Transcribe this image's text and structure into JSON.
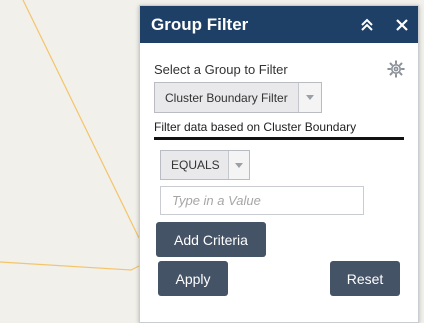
{
  "map": {
    "line_color": "#f4c46a",
    "background": "#f1f0ea"
  },
  "panel": {
    "title": "Group Filter",
    "collapse_icon": "double-chevron-up-icon",
    "close_icon": "close-icon",
    "select_group_label": "Select a Group to Filter",
    "settings_icon": "gear-icon",
    "group_dropdown": {
      "selected": "Cluster Boundary Filter"
    },
    "description": "Filter data based on Cluster Boundary",
    "operator_dropdown": {
      "selected": "EQUALS"
    },
    "value_input": {
      "value": "",
      "placeholder": "Type in a Value"
    },
    "add_criteria_label": "Add Criteria",
    "apply_label": "Apply",
    "reset_label": "Reset",
    "colors": {
      "header": "#1e3f66",
      "button": "#455366"
    }
  }
}
